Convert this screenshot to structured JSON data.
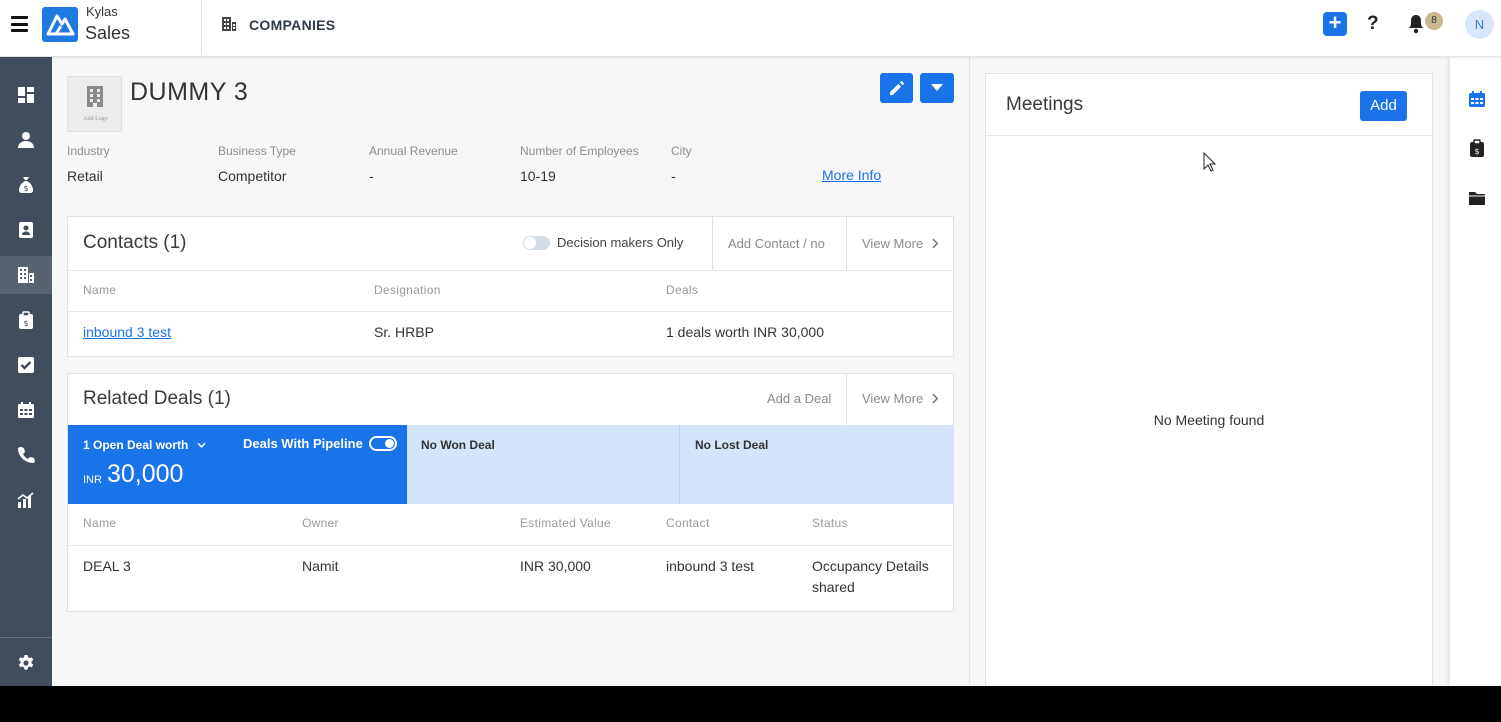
{
  "header": {
    "brand_top": "Kylas",
    "brand_bottom": "Sales",
    "module_title": "COMPANIES",
    "notification_count": "8",
    "avatar_initial": "N"
  },
  "sidebar": {
    "items": [
      {
        "name": "dashboard",
        "icon": "dashboard-icon"
      },
      {
        "name": "contacts",
        "icon": "user-icon"
      },
      {
        "name": "deals",
        "icon": "money-bag-icon"
      },
      {
        "name": "leads",
        "icon": "contact-card-icon"
      },
      {
        "name": "companies",
        "icon": "building-icon",
        "active": true
      },
      {
        "name": "quotes",
        "icon": "clipboard-icon"
      },
      {
        "name": "tasks",
        "icon": "checkbox-icon"
      },
      {
        "name": "meetings",
        "icon": "calendar-icon"
      },
      {
        "name": "calls",
        "icon": "phone-icon"
      },
      {
        "name": "reports",
        "icon": "chart-icon"
      },
      {
        "name": "settings",
        "icon": "gear-icon"
      }
    ]
  },
  "company": {
    "logo_label": "Add Logo",
    "name": "DUMMY 3",
    "fields": [
      {
        "label": "Industry",
        "value": "Retail"
      },
      {
        "label": "Business Type",
        "value": "Competitor"
      },
      {
        "label": "Annual Revenue",
        "value": "-"
      },
      {
        "label": "Number of Employees",
        "value": "10-19"
      },
      {
        "label": "City",
        "value": "-"
      }
    ],
    "more_info": "More Info"
  },
  "contacts": {
    "title": "Contacts (1)",
    "decision_makers_label": "Decision makers Only",
    "add_label": "Add Contact / no",
    "view_more": "View More",
    "columns": [
      "Name",
      "Designation",
      "Deals"
    ],
    "rows": [
      {
        "name": "inbound 3 test",
        "designation": "Sr. HRBP",
        "deals": "1 deals worth INR 30,000"
      }
    ]
  },
  "deals": {
    "title": "Related Deals (1)",
    "add_label": "Add a Deal",
    "view_more": "View More",
    "open_label": "1 Open Deal worth",
    "pipeline_label": "Deals With Pipeline",
    "currency": "INR",
    "amount": "30,000",
    "won_label": "No Won Deal",
    "lost_label": "No Lost Deal",
    "columns": [
      "Name",
      "Owner",
      "Estimated Value",
      "Contact",
      "Status"
    ],
    "rows": [
      {
        "name": "DEAL 3",
        "owner": "Namit",
        "value": "INR 30,000",
        "contact": "inbound 3 test",
        "status": "Occupancy Details shared"
      }
    ]
  },
  "meetings": {
    "title": "Meetings",
    "add_label": "Add",
    "empty": "No Meeting found"
  },
  "right_rail": [
    "calendar-icon",
    "clipboard-icon",
    "folder-icon"
  ],
  "colors": {
    "primary": "#1a73e8",
    "sidebar": "#414c5c",
    "stage_light": "#d6e4fb"
  }
}
